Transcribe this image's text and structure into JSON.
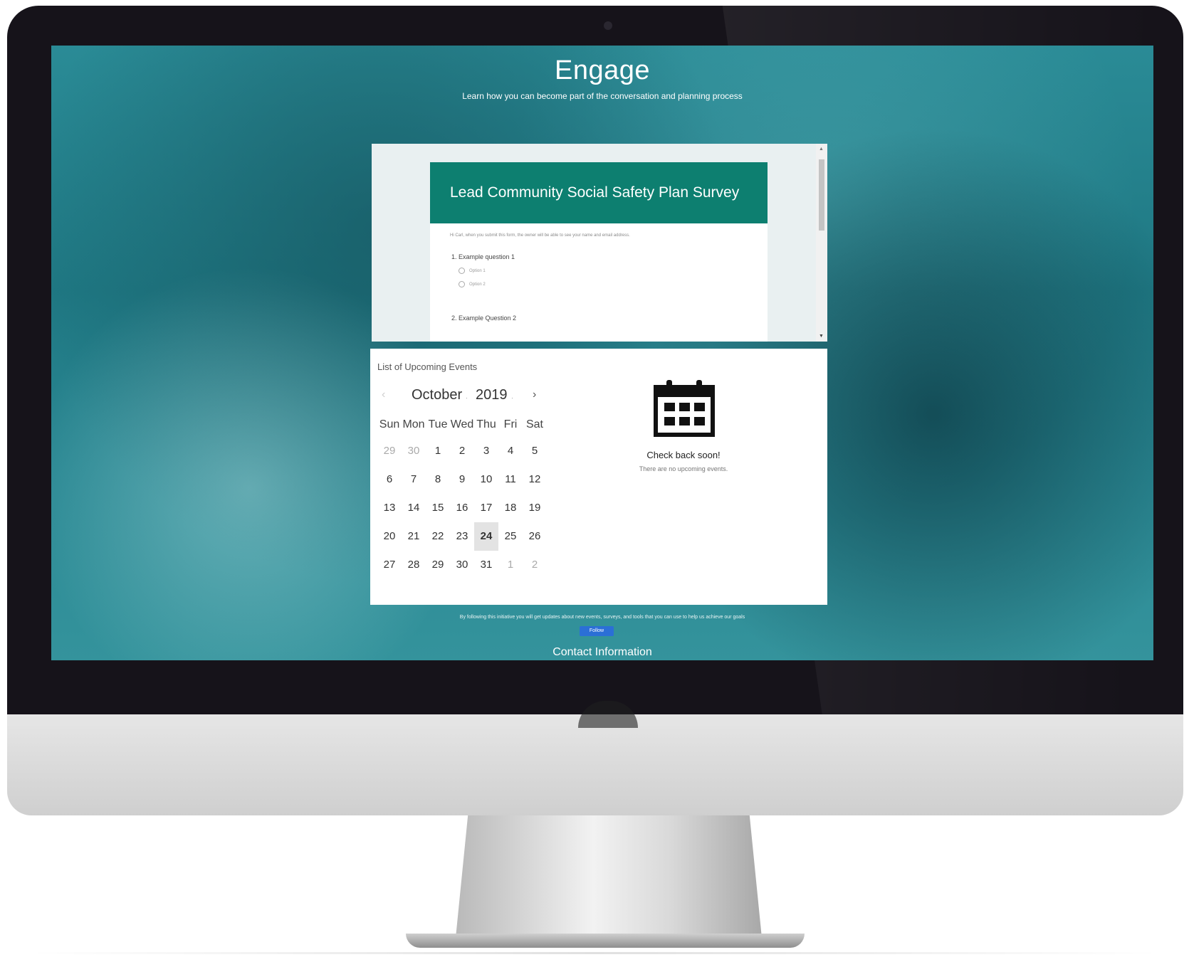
{
  "hero": {
    "title": "Engage",
    "subtitle": "Learn how you can become part of the conversation and planning process"
  },
  "survey": {
    "title": "Lead Community Social Safety Plan Survey",
    "note": "Hi Carl, when you submit this form, the owner will be able to see your name and email address.",
    "question1": "1. Example question 1",
    "options": [
      "Option 1",
      "Option 2"
    ],
    "question2": "2. Example Question 2"
  },
  "events": {
    "title": "List of Upcoming Events",
    "month": "October",
    "year": "2019",
    "weekdays": [
      "Sun",
      "Mon",
      "Tue",
      "Wed",
      "Thu",
      "Fri",
      "Sat"
    ],
    "weeks": [
      [
        "29",
        "30",
        "1",
        "2",
        "3",
        "4",
        "5"
      ],
      [
        "6",
        "7",
        "8",
        "9",
        "10",
        "11",
        "12"
      ],
      [
        "13",
        "14",
        "15",
        "16",
        "17",
        "18",
        "19"
      ],
      [
        "20",
        "21",
        "22",
        "23",
        "24",
        "25",
        "26"
      ],
      [
        "27",
        "28",
        "29",
        "30",
        "31",
        "1",
        "2"
      ]
    ],
    "today": "24",
    "empty_title": "Check back soon!",
    "empty_sub": "There are no upcoming events."
  },
  "follow": {
    "text": "By following this initiative you will get updates about new events, surveys, and tools that you can use to help us achieve our goals",
    "button": "Follow"
  },
  "contact": {
    "title": "Contact Information"
  }
}
